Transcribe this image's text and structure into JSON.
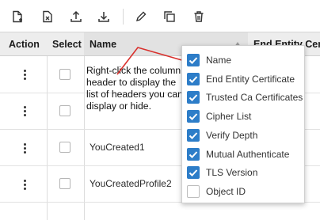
{
  "toolbar": {
    "icons": [
      "new-document-icon",
      "delete-record-icon",
      "upload-icon",
      "download-icon",
      "edit-icon",
      "duplicate-icon",
      "trash-icon"
    ]
  },
  "table": {
    "columns": [
      "Action",
      "Select",
      "Name",
      "End Entity Certif"
    ],
    "rows": [
      {
        "name": ""
      },
      {
        "name": ""
      },
      {
        "name": "YouCreated1"
      },
      {
        "name": "YouCreatedProfile2"
      }
    ]
  },
  "annotation": {
    "text": "Right-click the column header to display the list of headers you can display or hide."
  },
  "column_menu": {
    "items": [
      {
        "label": "Name",
        "checked": true
      },
      {
        "label": "End Entity Certificate",
        "checked": true
      },
      {
        "label": "Trusted Ca Certificates",
        "checked": true
      },
      {
        "label": "Cipher List",
        "checked": true
      },
      {
        "label": "Verify Depth",
        "checked": true
      },
      {
        "label": "Mutual Authenticate",
        "checked": true
      },
      {
        "label": "TLS Version",
        "checked": true
      },
      {
        "label": "Object ID",
        "checked": false
      }
    ]
  },
  "colors": {
    "accent": "#2d7dc8",
    "callout_line": "#d9302c",
    "header_bg": "#ededed"
  }
}
